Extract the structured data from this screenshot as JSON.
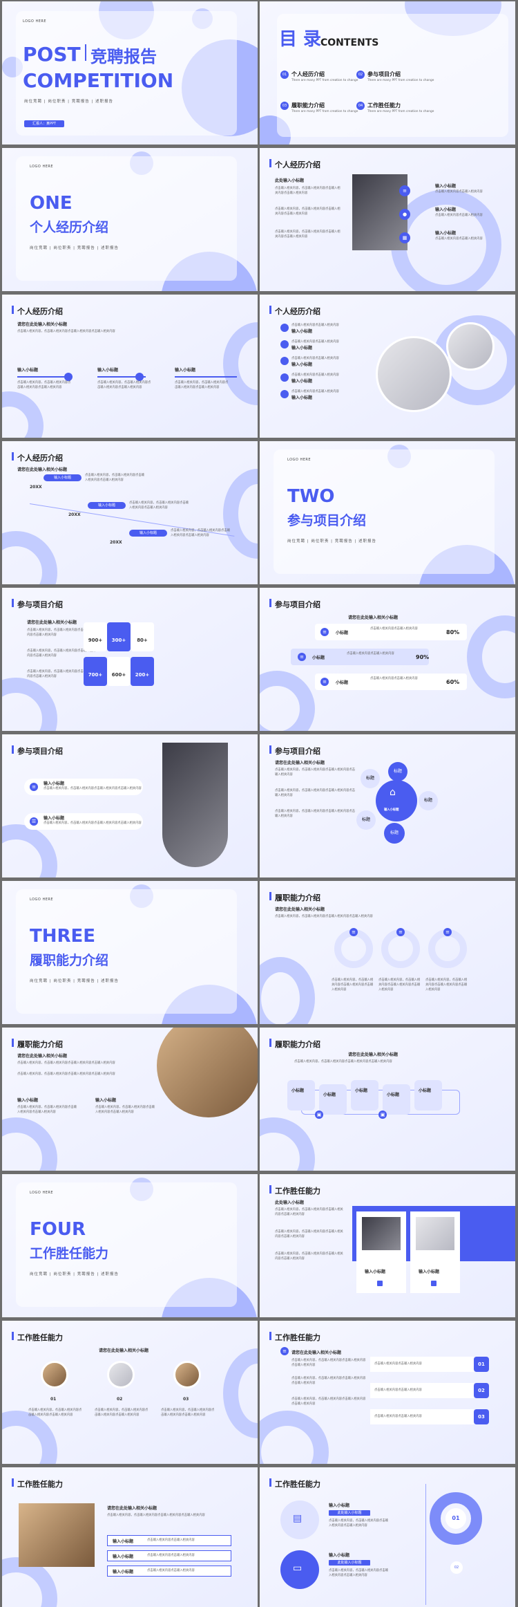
{
  "colors": {
    "accent": "#4a5cf0",
    "light": "#c7cfff",
    "bg": "#eef0ff"
  },
  "common": {
    "logo": "LOGO HERE",
    "sub_tags": "岗位竞聘 | 岗位职责 | 竞聘报告 | 述职报告",
    "filler": "点击输入相关文字",
    "filler_long": "点击输入相关内容，点击输入相关内容点击输入相关内容点击输入相关内容",
    "filler_short": "点击输入相关内容点击输入相关内容"
  },
  "cover": {
    "title_en": "POST",
    "title_cn": "竞聘报告",
    "title_en2": "COMPETITION",
    "tags": "岗位竞聘 | 岗位职责 | 竞聘报告 | 述职报告",
    "badge": "汇报人：某PPT"
  },
  "contents": {
    "title_cn": "目 录",
    "title_en": "CONTENTS",
    "desc": "There are many PPT from creation to change",
    "items": [
      {
        "num": "01",
        "label": "个人经历介绍"
      },
      {
        "num": "02",
        "label": "参与项目介绍"
      },
      {
        "num": "03",
        "label": "履职能力介绍"
      },
      {
        "num": "04",
        "label": "工作胜任能力"
      }
    ]
  },
  "sections": [
    {
      "num": "ONE",
      "label": "个人经历介绍"
    },
    {
      "num": "TWO",
      "label": "参与项目介绍"
    },
    {
      "num": "THREE",
      "label": "履职能力介绍"
    },
    {
      "num": "FOUR",
      "label": "工作胜任能力"
    }
  ],
  "headers": {
    "s1": "个人经历介绍",
    "s2": "参与项目介绍",
    "s3": "履职能力介绍",
    "s4": "工作胜任能力"
  },
  "labels": {
    "enter_title": "请您在此处输入相关小标题",
    "enter_small": "输入小标题",
    "small": "小标题",
    "tag": "标题",
    "year": "20XX",
    "this_title": "此处输入小标题"
  },
  "stats": {
    "a": [
      "900+",
      "300+",
      "80+"
    ],
    "b": [
      "700+",
      "600+",
      "200+"
    ]
  },
  "percents": [
    "80%",
    "90%",
    "60%"
  ],
  "nums4": [
    "01",
    "02",
    "03"
  ],
  "steps": [
    "01",
    "02",
    "03"
  ]
}
